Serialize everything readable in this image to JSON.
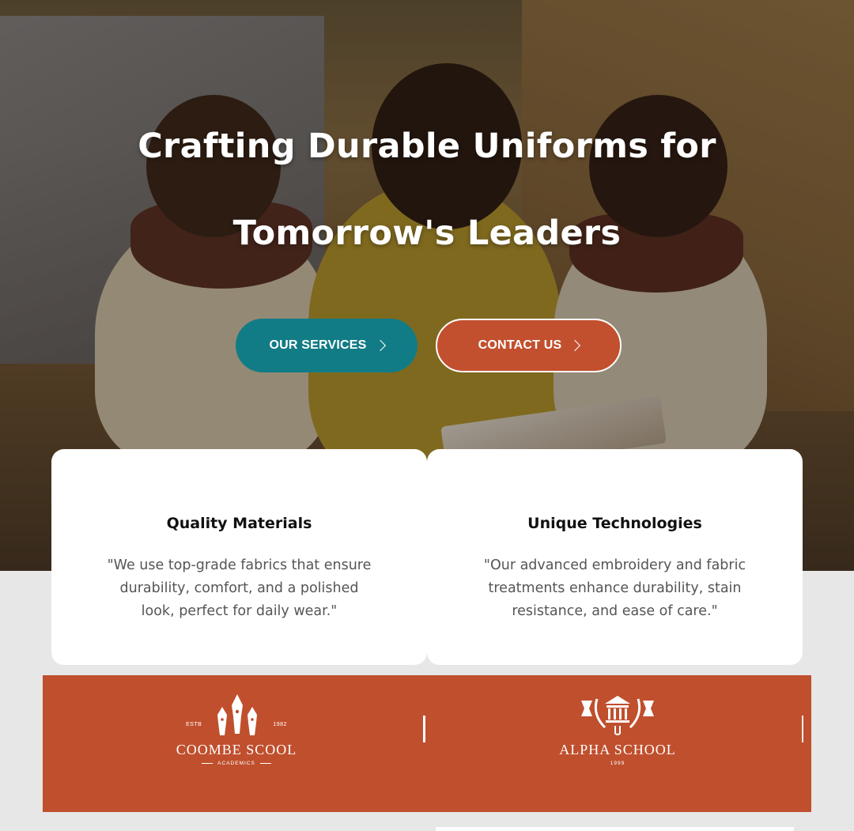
{
  "hero": {
    "title_line1": "Crafting Durable Uniforms for",
    "title_line2": "Tomorrow's Leaders",
    "buttons": {
      "services_label": "OUR SERVICES",
      "contact_label": "CONTACT US"
    }
  },
  "features": [
    {
      "title": "Quality Materials",
      "text": "\"We use top-grade fabrics that ensure durability, comfort, and a polished look, perfect for daily wear.\""
    },
    {
      "title": "Unique Technologies",
      "text": "\"Our advanced embroidery and fabric treatments enhance durability, stain resistance, and ease of care.\""
    }
  ],
  "logos": [
    {
      "estb_left": "ESTB",
      "estb_right": "1982",
      "name": "COOMBE SCOOL",
      "sub": "ACADEMICS",
      "icon": "pen-nibs-icon"
    },
    {
      "name": "ALPHA SCHOOL",
      "sub": "1999",
      "icon": "laurel-building-icon"
    }
  ],
  "colors": {
    "teal_button": "#127c86",
    "orange_button": "#c2502e",
    "band": "#c04f2d",
    "page_bg": "#e7e7e7"
  }
}
